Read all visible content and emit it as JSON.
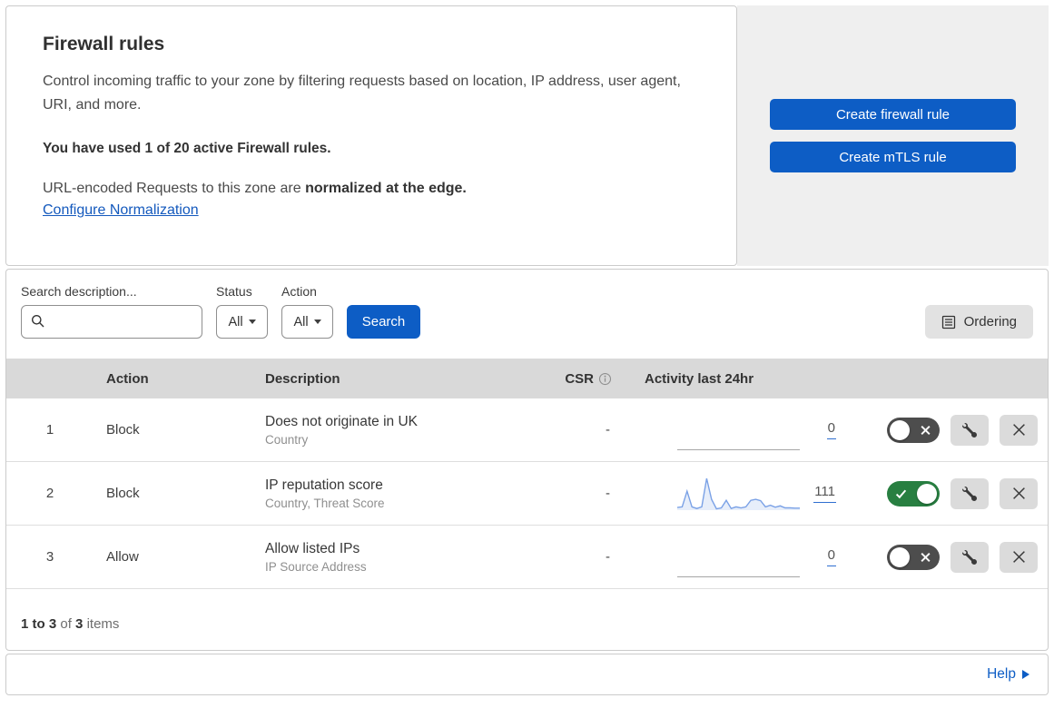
{
  "intro": {
    "title": "Firewall rules",
    "description": "Control incoming traffic to your zone by filtering requests based on location, IP address, user agent, URI, and more.",
    "usage": "You have used 1 of 20 active Firewall rules.",
    "normalization_prefix": "URL-encoded Requests to this zone are ",
    "normalization_bold": "normalized at the edge.",
    "normalization_link": "Configure Normalization"
  },
  "cta": {
    "create_firewall_rule": "Create firewall rule",
    "create_mtls_rule": "Create mTLS rule"
  },
  "filters": {
    "search_label": "Search description...",
    "search_value": "",
    "status_label": "Status",
    "status_value": "All",
    "action_label": "Action",
    "action_value": "All",
    "search_button": "Search",
    "ordering_button": "Ordering"
  },
  "table": {
    "headers": {
      "action": "Action",
      "description": "Description",
      "csr": "CSR",
      "activity": "Activity last 24hr"
    },
    "rows": [
      {
        "number": "1",
        "action": "Block",
        "description": "Does not originate in UK",
        "fields": "Country",
        "csr": "-",
        "activity_count": "0",
        "enabled": false
      },
      {
        "number": "2",
        "action": "Block",
        "description": "IP reputation score",
        "fields": "Country, Threat Score",
        "csr": "-",
        "activity_count": "111",
        "enabled": true
      },
      {
        "number": "3",
        "action": "Allow",
        "description": "Allow listed IPs",
        "fields": "IP Source Address",
        "csr": "-",
        "activity_count": "0",
        "enabled": false
      }
    ]
  },
  "sparkline": {
    "row_index": 1,
    "values": [
      0.08,
      0.1,
      0.58,
      0.1,
      0.05,
      0.1,
      0.97,
      0.33,
      0.04,
      0.07,
      0.3,
      0.05,
      0.1,
      0.07,
      0.1,
      0.3,
      0.33,
      0.29,
      0.1,
      0.15,
      0.09,
      0.13,
      0.07,
      0.07,
      0.06,
      0.06
    ],
    "line_color": "#7aa1e6",
    "fill_color": "rgba(122,161,230,0.18)"
  },
  "footer": {
    "range": "1 to 3",
    "of": "of",
    "total": "3",
    "items": "items"
  },
  "help": {
    "label": "Help"
  },
  "colors": {
    "accent_blue": "#0d5dc5",
    "toggle_on_green": "#287f41",
    "toggle_off_gray": "#4d4d4d",
    "panel_gray": "#efefef",
    "table_header_gray": "#d9d9d9"
  }
}
